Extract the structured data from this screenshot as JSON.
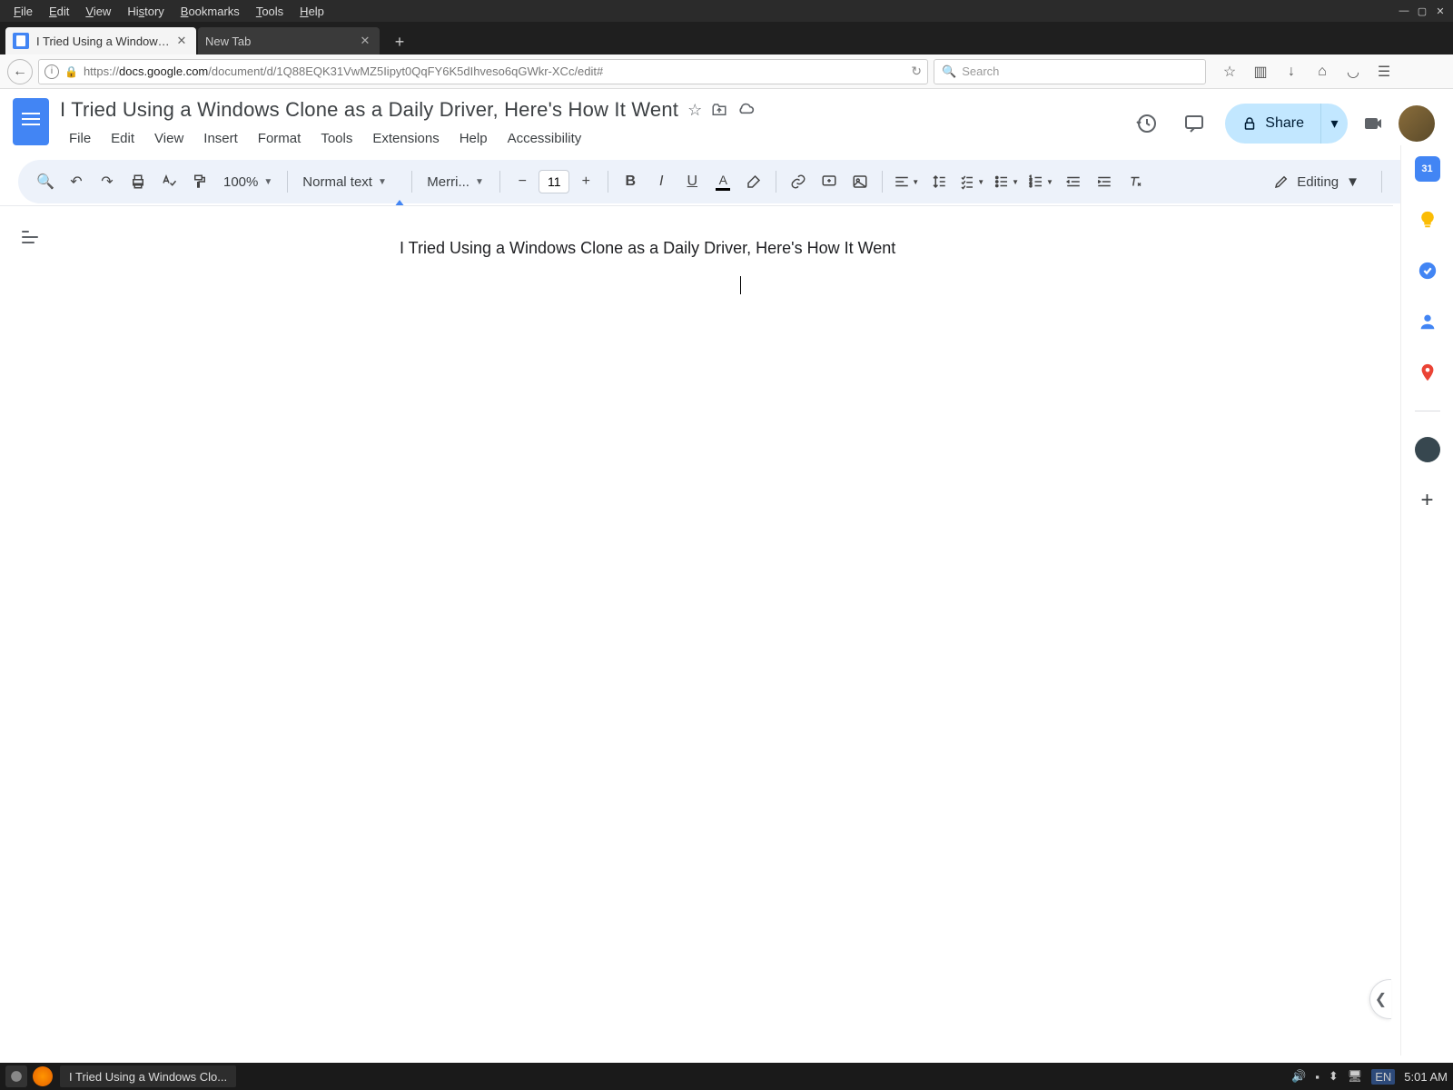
{
  "os_menu": [
    "File",
    "Edit",
    "View",
    "History",
    "Bookmarks",
    "Tools",
    "Help"
  ],
  "tabs": {
    "active": "I Tried Using a Windows Clon...",
    "inactive": "New Tab"
  },
  "url": {
    "prefix": "https://",
    "domain": "docs.google.com",
    "path": "/document/d/1Q88EQK31VwMZ5Iipyt0QqFY6K5dIhveso6qGWkr-XCc/edit#"
  },
  "search_placeholder": "Search",
  "document": {
    "title": "I Tried Using a Windows Clone as a Daily Driver, Here's How It Went",
    "body_text": "I Tried Using a Windows Clone as a Daily Driver, Here's How It Went"
  },
  "docs_menu": [
    "File",
    "Edit",
    "View",
    "Insert",
    "Format",
    "Tools",
    "Extensions",
    "Help",
    "Accessibility"
  ],
  "toolbar": {
    "zoom": "100%",
    "style": "Normal text",
    "font": "Merri...",
    "font_size": "11",
    "mode": "Editing"
  },
  "share_label": "Share",
  "taskbar": {
    "task_title": "I Tried Using a Windows Clo...",
    "lang": "EN",
    "time": "5:01 AM"
  }
}
